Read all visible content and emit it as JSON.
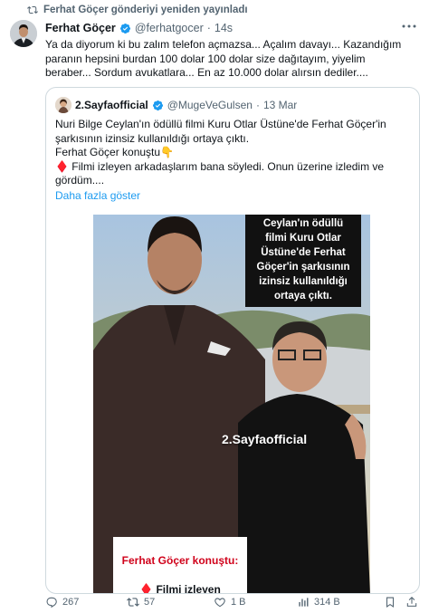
{
  "repost": {
    "label": "Ferhat Göçer gönderiyi yeniden yayınladı"
  },
  "tweet": {
    "author_name": "Ferhat Göçer",
    "handle": "@ferhatgocer",
    "separator": "·",
    "time": "14s",
    "text": "Ya da diyorum ki bu zalım telefon açmazsa... Açalım davayı... Kazandığım\nparanın hepsini burdan 100 dolar 100 dolar size dağıtayım, yiyelim\nberaber... Sordum avukatlara... En az 10.000 dolar alırsın dediler...."
  },
  "quote": {
    "author_name": "2.Sayfaofficial",
    "handle": "@MugeVeGulsen",
    "separator": "·",
    "time": "13 Mar",
    "text": "Nuri Bilge Ceylan'ın ödüllü filmi Kuru Otlar Üstüne'de Ferhat Göçer'in\nşarkısının izinsiz kullanıldığı ortaya çıktı.\nFerhat Göçer konuştu👇\n♦️ Filmi izleyen arkadaşlarım bana söyledi. Onun üzerine izledim ve\ngördüm....",
    "show_more": "Daha fazla göster",
    "media": {
      "overlay_top": "Ceylan'ın ödüllü\nfilmi Kuru Otlar\nÜstüne'de Ferhat\nGöçer'in şarkısının\nizinsiz kullanıldığı\nortaya çıktı.",
      "watermark": "2.Sayfaofficial",
      "overlay_bottom_red": "Ferhat Göçer konuştu:",
      "overlay_bottom_black": "♦️ Filmi izleyen\narkadaşlarım bana"
    }
  },
  "actions": {
    "replies": "267",
    "reposts": "57",
    "likes": "1 B",
    "views": "314 B"
  },
  "colors": {
    "verified": "#1d9bf0",
    "link": "#1d9bf0",
    "secondary_text": "#536471",
    "border": "#cfd9de"
  },
  "icons": [
    "repost-icon",
    "verified-badge-icon",
    "more-icon",
    "reply-icon",
    "like-icon",
    "views-icon",
    "bookmark-icon",
    "share-icon"
  ]
}
